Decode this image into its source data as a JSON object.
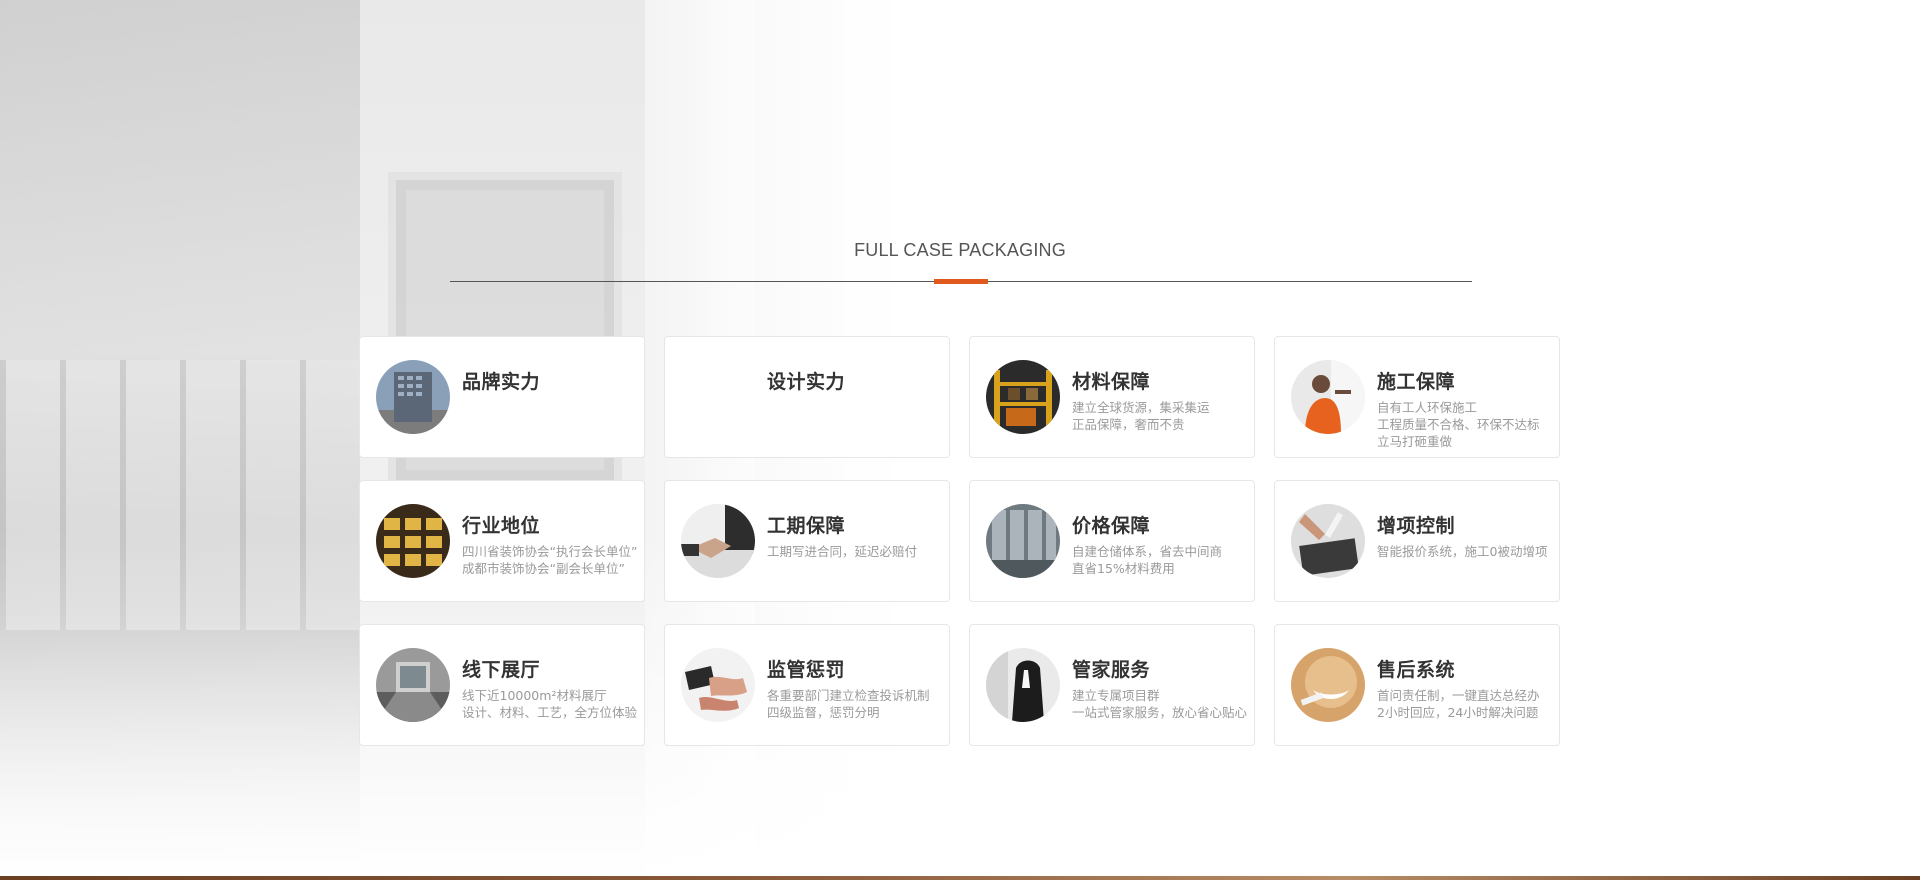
{
  "section": {
    "title": "FULL CASE PACKAGING",
    "accent_color": "#e05a20"
  },
  "cards": [
    {
      "title": "品牌实力",
      "lines": [],
      "icon": "building-icon",
      "has_image": true
    },
    {
      "title": "设计实力",
      "lines": [],
      "icon": "",
      "has_image": false
    },
    {
      "title": "材料保障",
      "lines": [
        "建立全球货源，集采集运",
        "正品保障，奢而不贵"
      ],
      "icon": "warehouse-icon",
      "has_image": true
    },
    {
      "title": "施工保障",
      "lines": [
        "自有工人环保施工",
        "工程质量不合格、环保不达标",
        "立马打砸重做"
      ],
      "icon": "worker-icon",
      "has_image": true
    },
    {
      "title": "行业地位",
      "lines": [
        "四川省装饰协会“执行会长单位”",
        "成都市装饰协会“副会长单位”"
      ],
      "icon": "award-wall-icon",
      "has_image": true
    },
    {
      "title": "工期保障",
      "lines": [
        "工期写进合同，延迟必赔付"
      ],
      "icon": "handshake-icon",
      "has_image": true
    },
    {
      "title": "价格保障",
      "lines": [
        "自建仓储体系，省去中间商",
        "直省15%材料费用"
      ],
      "icon": "glass-wall-icon",
      "has_image": true
    },
    {
      "title": "增项控制",
      "lines": [
        "智能报价系统，施工0被动增项"
      ],
      "icon": "calculator-icon",
      "has_image": true
    },
    {
      "title": "线下展厅",
      "lines": [
        "线下近10000m²材料展厅",
        "设计、材料、工艺，全方位体验"
      ],
      "icon": "showroom-icon",
      "has_image": true
    },
    {
      "title": "监管惩罚",
      "lines": [
        "各重要部门建立检查投诉机制",
        "四级监督，惩罚分明"
      ],
      "icon": "hands-icon",
      "has_image": true
    },
    {
      "title": "管家服务",
      "lines": [
        "建立专属项目群",
        "一站式管家服务，放心省心贴心"
      ],
      "icon": "butler-icon",
      "has_image": true
    },
    {
      "title": "售后系统",
      "lines": [
        "首问责任制，一键直达总经办",
        "2小时回应，24小时解决问题"
      ],
      "icon": "smile-icon",
      "has_image": true
    }
  ]
}
